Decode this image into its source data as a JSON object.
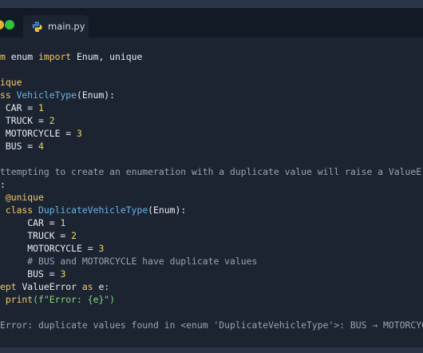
{
  "window": {
    "tab": {
      "label": "main.py",
      "icon": "python-icon"
    }
  },
  "colors": {
    "keyword": "#f5c765",
    "class_name": "#6bb5e6",
    "string": "#88d47c",
    "number": "#e8d56a",
    "comment": "#9aa3b2",
    "text": "#e8ecf2",
    "editor_background": "#1c2432",
    "titlebar_background": "#121a26",
    "frame_background": "#2a3647"
  },
  "code": {
    "lines": [
      [
        {
          "t": "m ",
          "c": "kw"
        },
        {
          "t": "enum ",
          "c": "tok"
        },
        {
          "t": "import",
          "c": "kw"
        },
        {
          "t": " Enum, unique",
          "c": "tok"
        }
      ],
      [],
      [
        {
          "t": "ique",
          "c": "dec"
        }
      ],
      [
        {
          "t": "ss ",
          "c": "kw"
        },
        {
          "t": "VehicleType",
          "c": "cls"
        },
        {
          "t": "(Enum):",
          "c": "tok"
        }
      ],
      [
        {
          "t": " CAR = ",
          "c": "tok"
        },
        {
          "t": "1",
          "c": "num"
        }
      ],
      [
        {
          "t": " TRUCK = ",
          "c": "tok"
        },
        {
          "t": "2",
          "c": "num"
        }
      ],
      [
        {
          "t": " MOTORCYCLE = ",
          "c": "tok"
        },
        {
          "t": "3",
          "c": "num"
        }
      ],
      [
        {
          "t": " BUS = ",
          "c": "tok"
        },
        {
          "t": "4",
          "c": "num"
        }
      ],
      [],
      [
        {
          "t": "ttempting to create an enumeration with a duplicate value will raise a ValueError",
          "c": "cmt"
        }
      ],
      [
        {
          "t": ":",
          "c": "tok"
        }
      ],
      [
        {
          "t": " @unique",
          "c": "dec"
        }
      ],
      [
        {
          "t": " class ",
          "c": "kw"
        },
        {
          "t": "DuplicateVehicleType",
          "c": "cls"
        },
        {
          "t": "(Enum):",
          "c": "tok"
        }
      ],
      [
        {
          "t": "     CAR = ",
          "c": "tok"
        },
        {
          "t": "1",
          "c": "num"
        }
      ],
      [
        {
          "t": "     TRUCK = ",
          "c": "tok"
        },
        {
          "t": "2",
          "c": "num"
        }
      ],
      [
        {
          "t": "     MOTORCYCLE = ",
          "c": "tok"
        },
        {
          "t": "3",
          "c": "num"
        }
      ],
      [
        {
          "t": "     # BUS and MOTORCYCLE have duplicate values",
          "c": "cmt"
        }
      ],
      [
        {
          "t": "     BUS = ",
          "c": "tok"
        },
        {
          "t": "3",
          "c": "num"
        }
      ],
      [
        {
          "t": "ept ",
          "c": "kw"
        },
        {
          "t": "ValueError ",
          "c": "tok"
        },
        {
          "t": "as",
          "c": "kw"
        },
        {
          "t": " e:",
          "c": "tok"
        }
      ],
      [
        {
          "t": " print",
          "c": "kw"
        },
        {
          "t": "(f\"Error: {e}\")",
          "c": "str"
        }
      ],
      [],
      [
        {
          "t": "Error: duplicate values found in <enum 'DuplicateVehicleType'>: BUS → MOTORCYCLE",
          "c": "cmt"
        }
      ]
    ]
  }
}
